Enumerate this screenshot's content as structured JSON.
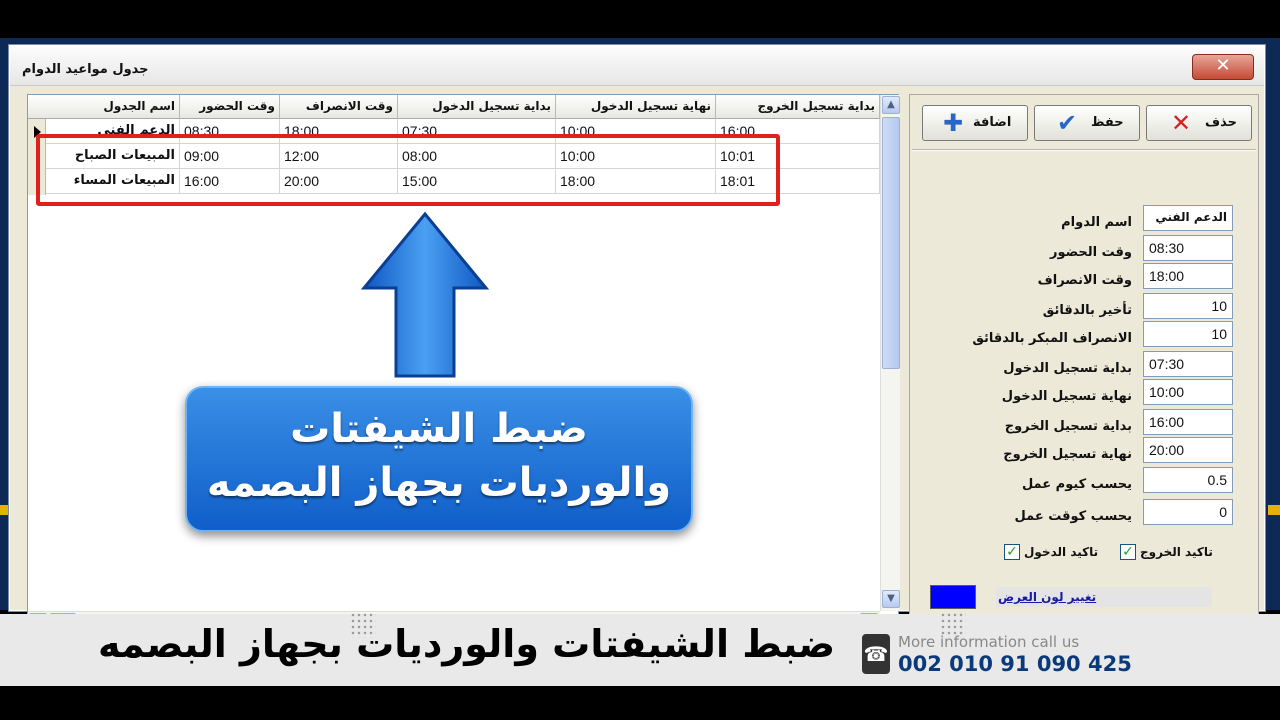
{
  "window": {
    "title": "جدول مواعيد الدوام",
    "close_glyph": "✕"
  },
  "grid": {
    "columns": [
      "اسم الجدول",
      "وقت الحضور",
      "وقت الانصراف",
      "بداية تسجيل الدخول",
      "نهاية تسجيل الدخول",
      "بداية تسجيل الخروج"
    ],
    "rows": [
      {
        "name": "الدعم الفني",
        "in": "08:30",
        "out": "18:00",
        "login_start": "07:30",
        "login_end": "10:00",
        "logout_start": "16:00"
      },
      {
        "name": "المبيعات الصباح",
        "in": "09:00",
        "out": "12:00",
        "login_start": "08:00",
        "login_end": "10:00",
        "logout_start": "10:01"
      },
      {
        "name": "المبيعات المساء",
        "in": "16:00",
        "out": "20:00",
        "login_start": "15:00",
        "login_end": "18:00",
        "logout_start": "18:01"
      }
    ]
  },
  "overlay": {
    "line1": "ضبط الشيفتات",
    "line2": "والورديات بجهاز البصمه",
    "arrow_color": "#1f6fe0",
    "highlight_color": "#e0201c"
  },
  "toolbar": {
    "delete_label": "حذف",
    "save_label": "حفظ",
    "add_label": "اضافة",
    "delete_icon": "close-icon",
    "save_icon": "check-icon",
    "add_icon": "plus-icon"
  },
  "form": {
    "fields": [
      {
        "label": "اسم الدوام",
        "value": "الدعم الفني"
      },
      {
        "label": "وقت الحضور",
        "value": "08:30"
      },
      {
        "label": "وقت الانصراف",
        "value": "18:00"
      },
      {
        "label": "تأخير بالدقائق",
        "value": "10"
      },
      {
        "label": "الانصراف المبكر بالدقائق",
        "value": "10"
      },
      {
        "label": "بداية تسجيل الدخول",
        "value": "07:30"
      },
      {
        "label": "نهاية تسجيل الدخول",
        "value": "10:00"
      },
      {
        "label": "بداية تسجيل الخروج",
        "value": "16:00"
      },
      {
        "label": "نهاية تسجيل الخروج",
        "value": "20:00"
      },
      {
        "label": "يحسب كيوم عمل",
        "value": "0.5"
      },
      {
        "label": "يحسب كوقت عمل",
        "value": "0"
      }
    ],
    "confirm_logout_label": "تاكيد الخروج",
    "confirm_logout_checked": true,
    "confirm_login_label": "تاكيد الدخول",
    "confirm_login_checked": true,
    "display_color": "#0000ff",
    "change_color_label": "تغيير لون العرض"
  },
  "footer": {
    "title": "ضبط الشيفتات والورديات بجهاز البصمه",
    "more_info": "More information call us",
    "phone": "002 010 91 090 425"
  }
}
